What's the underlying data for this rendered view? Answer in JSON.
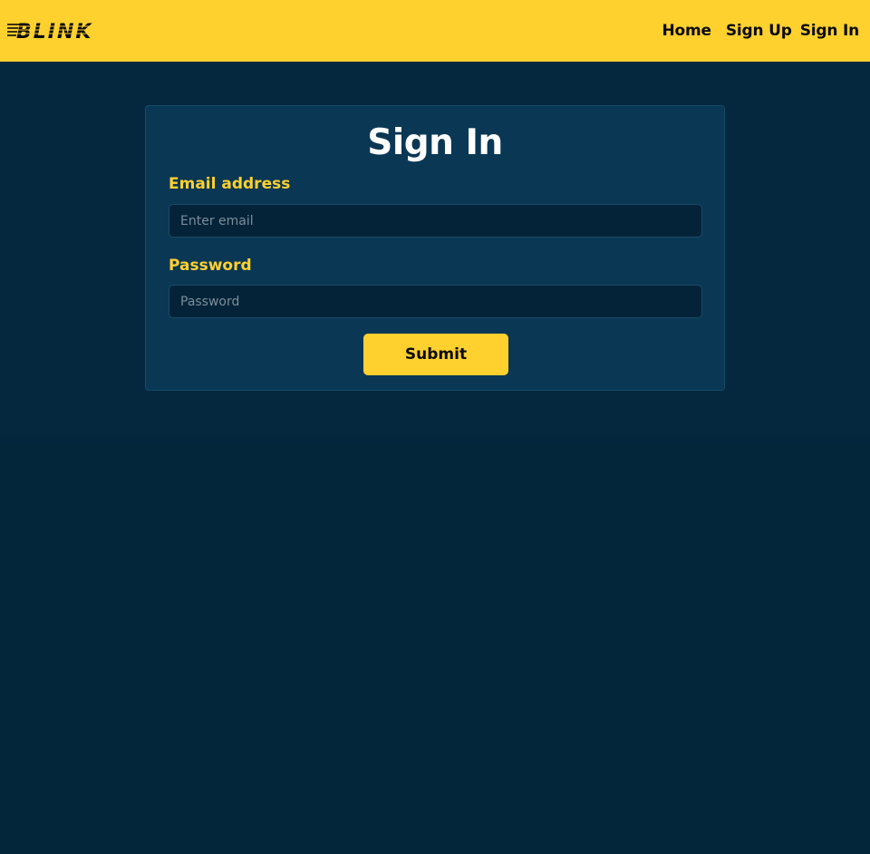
{
  "brand": {
    "logo_text": "BLINK",
    "colors": {
      "accent": "#ffd12f",
      "background": "#05283f",
      "card": "#0a3754",
      "input": "#042339"
    }
  },
  "nav": {
    "links": [
      {
        "label": "Home"
      },
      {
        "label": "Sign Up"
      },
      {
        "label": "Sign In"
      }
    ]
  },
  "form": {
    "title": "Sign In",
    "email": {
      "label": "Email address",
      "placeholder": "Enter email",
      "value": ""
    },
    "password": {
      "label": "Password",
      "placeholder": "Password",
      "value": ""
    },
    "submit_label": "Submit"
  }
}
